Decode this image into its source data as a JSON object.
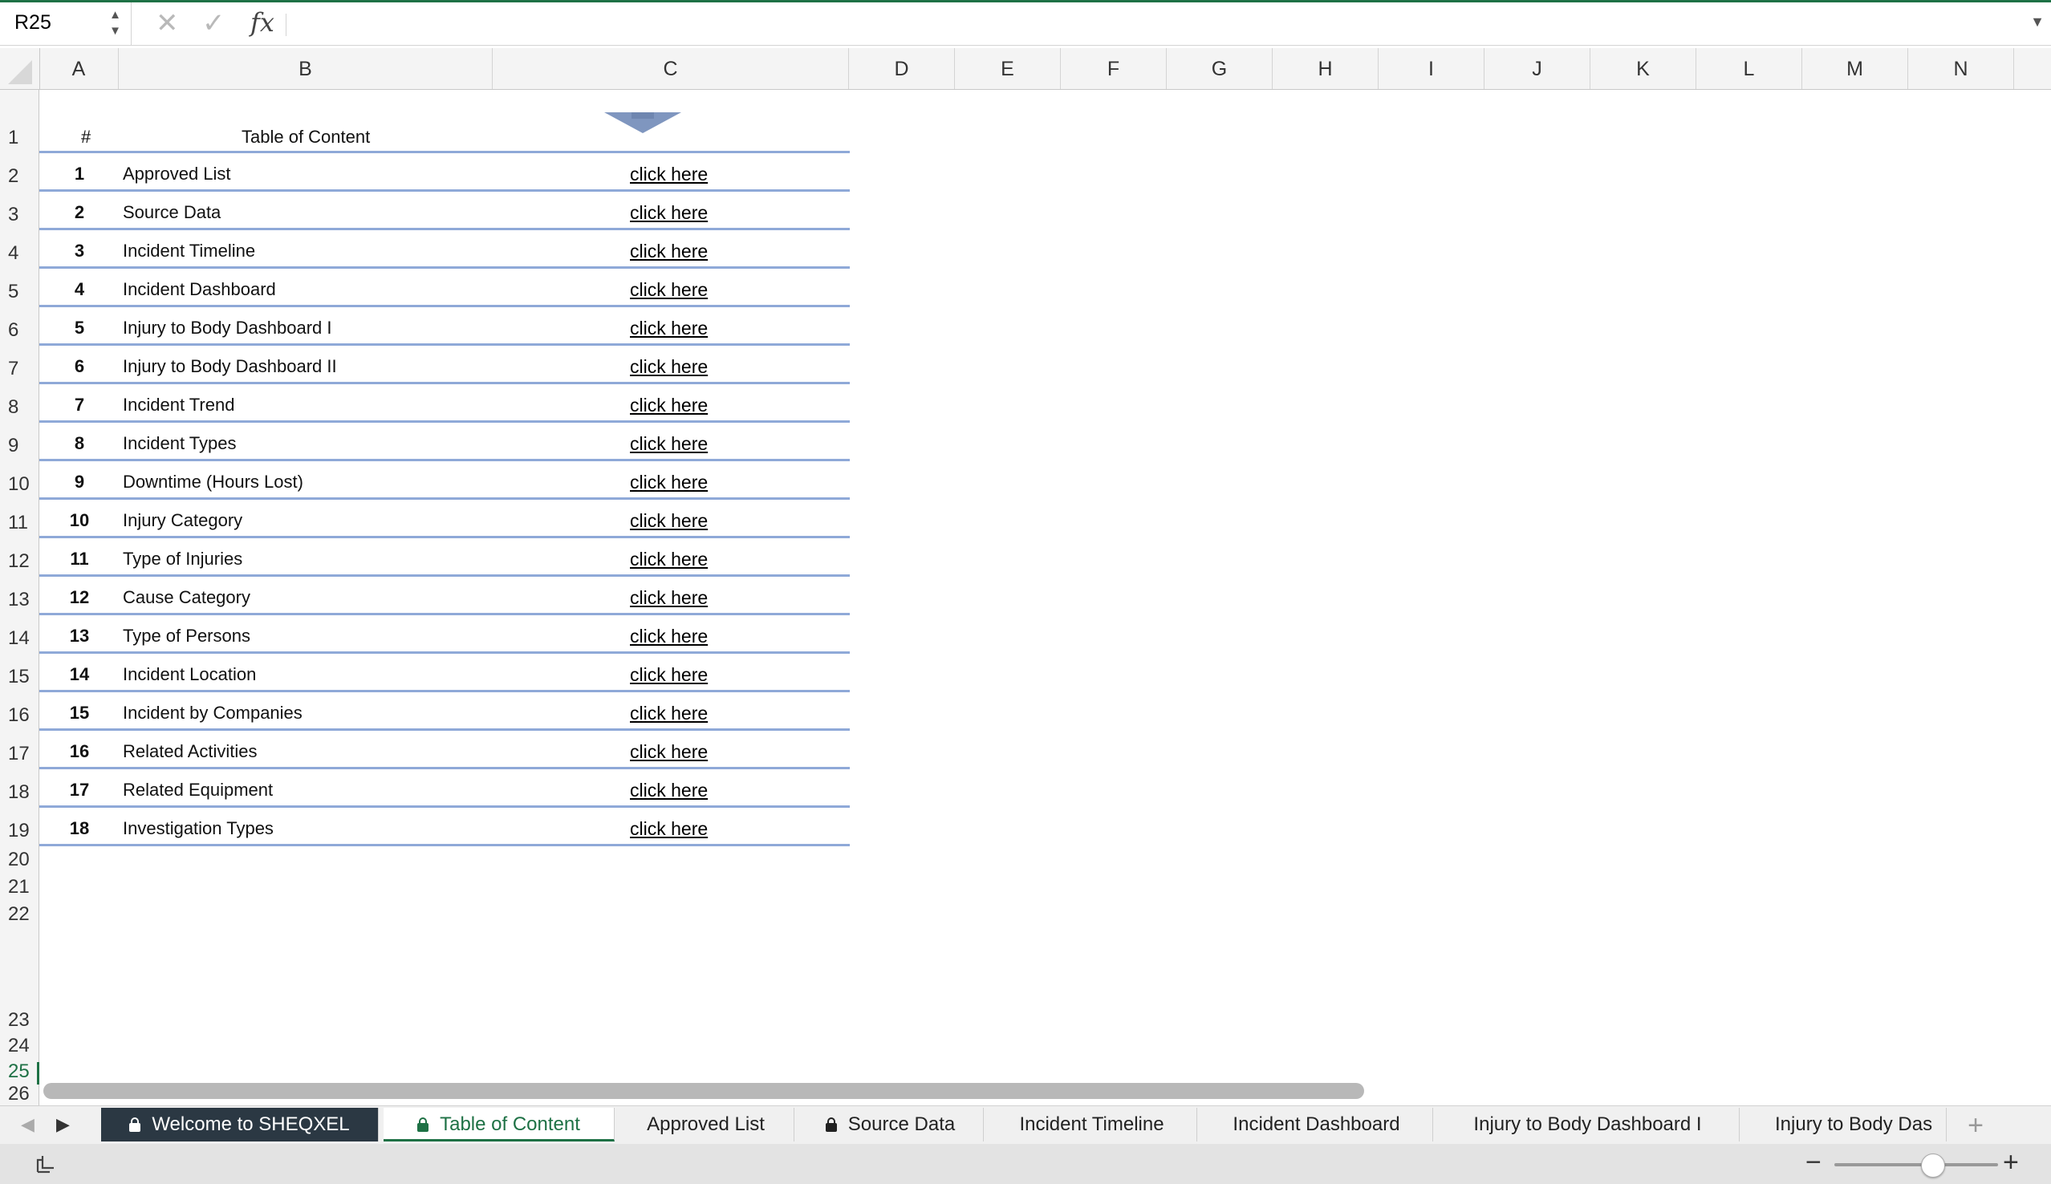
{
  "formula_bar": {
    "name_box": "R25",
    "formula": ""
  },
  "columns": [
    "A",
    "B",
    "C",
    "D",
    "E",
    "F",
    "G",
    "H",
    "I",
    "J",
    "K",
    "L",
    "M",
    "N"
  ],
  "rows": [
    "1",
    "2",
    "3",
    "4",
    "5",
    "6",
    "7",
    "8",
    "9",
    "10",
    "11",
    "12",
    "13",
    "14",
    "15",
    "16",
    "17",
    "18",
    "19",
    "20",
    "21",
    "22",
    "23",
    "24",
    "25",
    "26"
  ],
  "active_row": "25",
  "toc": {
    "num_header": "#",
    "title_header": "Table of Content",
    "items": [
      {
        "num": "1",
        "title": "Approved List",
        "link": "click here"
      },
      {
        "num": "2",
        "title": "Source Data",
        "link": "click here"
      },
      {
        "num": "3",
        "title": "Incident Timeline",
        "link": "click here"
      },
      {
        "num": "4",
        "title": "Incident Dashboard",
        "link": "click here"
      },
      {
        "num": "5",
        "title": "Injury to Body Dashboard I",
        "link": "click here"
      },
      {
        "num": "6",
        "title": "Injury to Body Dashboard II",
        "link": "click here"
      },
      {
        "num": "7",
        "title": "Incident Trend",
        "link": "click here"
      },
      {
        "num": "8",
        "title": "Incident Types",
        "link": "click here"
      },
      {
        "num": "9",
        "title": "Downtime (Hours Lost)",
        "link": "click here"
      },
      {
        "num": "10",
        "title": "Injury Category",
        "link": "click here"
      },
      {
        "num": "11",
        "title": "Type of Injuries",
        "link": "click here"
      },
      {
        "num": "12",
        "title": "Cause Category",
        "link": "click here"
      },
      {
        "num": "13",
        "title": "Type of Persons",
        "link": "click here"
      },
      {
        "num": "14",
        "title": "Incident Location",
        "link": "click here"
      },
      {
        "num": "15",
        "title": "Incident by Companies",
        "link": "click here"
      },
      {
        "num": "16",
        "title": "Related Activities",
        "link": "click here"
      },
      {
        "num": "17",
        "title": "Related Equipment",
        "link": "click here"
      },
      {
        "num": "18",
        "title": "Investigation Types",
        "link": "click here"
      }
    ]
  },
  "sheet_tabs": [
    {
      "label": "Welcome to SHEQXEL",
      "locked": true,
      "style": "dark"
    },
    {
      "label": "Table of Content",
      "locked": true,
      "style": "active"
    },
    {
      "label": "Approved List",
      "locked": false,
      "style": ""
    },
    {
      "label": "Source Data",
      "locked": true,
      "style": ""
    },
    {
      "label": "Incident Timeline",
      "locked": false,
      "style": ""
    },
    {
      "label": "Incident Dashboard",
      "locked": false,
      "style": ""
    },
    {
      "label": "Injury to Body Dashboard I",
      "locked": false,
      "style": ""
    },
    {
      "label": "Injury to Body Das",
      "locked": false,
      "style": ""
    }
  ],
  "status_bar": {
    "zoom_minus": "−",
    "zoom_plus": "+",
    "zoom_level": 0.6
  },
  "colors": {
    "accent": "#1e7145",
    "toc_line": "#8fa9d8",
    "arrow": "#7f96bf",
    "dark_tab": "#2b3843"
  }
}
